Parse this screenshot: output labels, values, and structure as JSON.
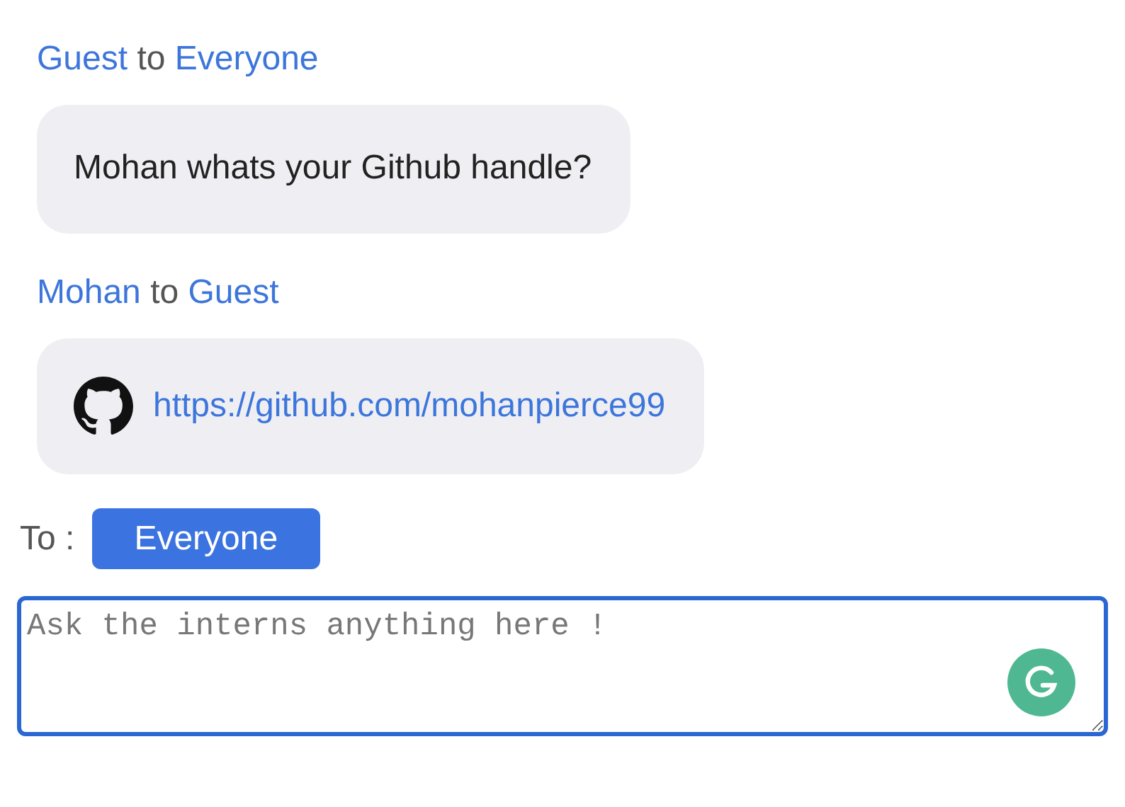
{
  "messages": [
    {
      "sender": "Guest",
      "connector": "to",
      "recipient": "Everyone",
      "kind": "text",
      "text": "Mohan whats your Github handle?"
    },
    {
      "sender": "Mohan",
      "connector": "to",
      "recipient": "Guest",
      "kind": "link",
      "text": "https://github.com/mohanpierce99"
    }
  ],
  "composer": {
    "to_label": "To :",
    "recipient": "Everyone",
    "placeholder": "Ask the interns anything here !"
  }
}
